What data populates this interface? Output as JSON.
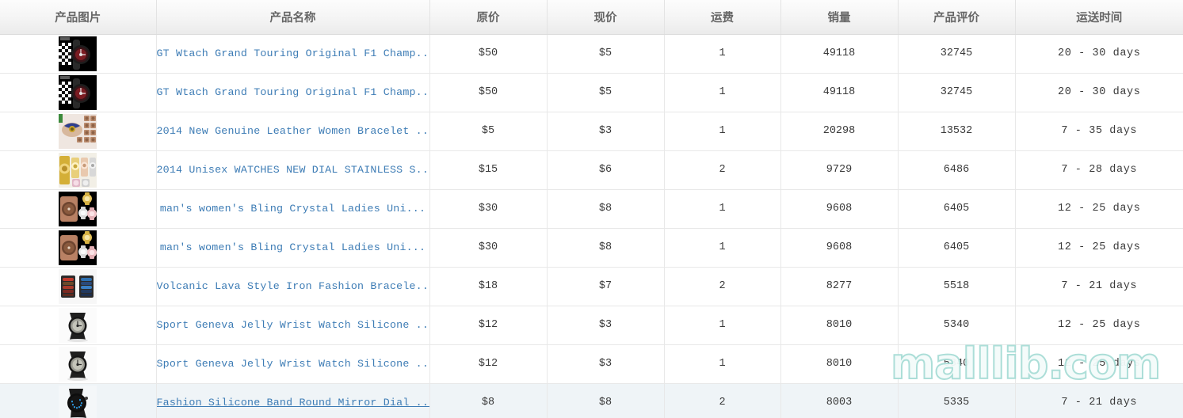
{
  "table": {
    "columns": [
      {
        "key": "image",
        "label": "产品图片"
      },
      {
        "key": "name",
        "label": "产品名称"
      },
      {
        "key": "orig_price",
        "label": "原价"
      },
      {
        "key": "cur_price",
        "label": "现价"
      },
      {
        "key": "shipping_fee",
        "label": "运费"
      },
      {
        "key": "sales",
        "label": "销量"
      },
      {
        "key": "reviews",
        "label": "产品评价"
      },
      {
        "key": "ship_time",
        "label": "运送时间"
      }
    ],
    "rows": [
      {
        "image_alt": "product-thumbnail-gt-watch-f1-chequered",
        "name": "GT Wtach Grand Touring Original F1 Champ...",
        "orig_price": "$50",
        "cur_price": "$5",
        "shipping_fee": "1",
        "sales": "49118",
        "reviews": "32745",
        "ship_time": "20 - 30 days",
        "highlight": false
      },
      {
        "image_alt": "product-thumbnail-gt-watch-f1-chequered",
        "name": "GT Wtach Grand Touring Original F1 Champ...",
        "orig_price": "$50",
        "cur_price": "$5",
        "shipping_fee": "1",
        "sales": "49118",
        "reviews": "32745",
        "ship_time": "20 - 30 days",
        "highlight": false
      },
      {
        "image_alt": "product-thumbnail-leather-bracelet-women",
        "name": "2014 New Genuine Leather Women Bracelet ...",
        "orig_price": "$5",
        "cur_price": "$3",
        "shipping_fee": "1",
        "sales": "20298",
        "reviews": "13532",
        "ship_time": "7 - 35 days",
        "highlight": false
      },
      {
        "image_alt": "product-thumbnail-unisex-stainless-watches",
        "name": "2014 Unisex WATCHES NEW DIAL STAINLESS S...",
        "orig_price": "$15",
        "cur_price": "$6",
        "shipping_fee": "2",
        "sales": "9729",
        "reviews": "6486",
        "ship_time": "7 - 28 days",
        "highlight": false
      },
      {
        "image_alt": "product-thumbnail-bling-crystal-ladies",
        "name": "man's women's Bling Crystal Ladies Uni...",
        "orig_price": "$30",
        "cur_price": "$8",
        "shipping_fee": "1",
        "sales": "9608",
        "reviews": "6405",
        "ship_time": "12 - 25 days",
        "highlight": false
      },
      {
        "image_alt": "product-thumbnail-bling-crystal-ladies",
        "name": "man's women's Bling Crystal Ladies Uni...",
        "orig_price": "$30",
        "cur_price": "$8",
        "shipping_fee": "1",
        "sales": "9608",
        "reviews": "6405",
        "ship_time": "12 - 25 days",
        "highlight": false
      },
      {
        "image_alt": "product-thumbnail-volcanic-lava-iron-bracelet",
        "name": "Volcanic Lava Style Iron Fashion Bracele...",
        "orig_price": "$18",
        "cur_price": "$7",
        "shipping_fee": "2",
        "sales": "8277",
        "reviews": "5518",
        "ship_time": "7 - 21 days",
        "highlight": false
      },
      {
        "image_alt": "product-thumbnail-geneva-jelly-silicone-watch",
        "name": "Sport Geneva Jelly Wrist Watch Silicone ...",
        "orig_price": "$12",
        "cur_price": "$3",
        "shipping_fee": "1",
        "sales": "8010",
        "reviews": "5340",
        "ship_time": "12 - 25 days",
        "highlight": false
      },
      {
        "image_alt": "product-thumbnail-geneva-jelly-silicone-watch",
        "name": "Sport Geneva Jelly Wrist Watch Silicone ...",
        "orig_price": "$12",
        "cur_price": "$3",
        "shipping_fee": "1",
        "sales": "8010",
        "reviews": "5340",
        "ship_time": "12 - 25 days",
        "highlight": false
      },
      {
        "image_alt": "product-thumbnail-silicone-band-mirror-dial-led",
        "name": "Fashion Silicone Band Round Mirror Dial ...",
        "orig_price": "$8",
        "cur_price": "$8",
        "shipping_fee": "2",
        "sales": "8003",
        "reviews": "5335",
        "ship_time": "7 - 21 days",
        "highlight": true
      }
    ]
  },
  "watermark": {
    "text": "malllib.com"
  },
  "colors": {
    "link": "#3d7cb5",
    "header_text": "#666666",
    "cell_text": "#3a3a3a",
    "row_highlight": "#eff4f7",
    "border": "#e8e8e8",
    "watermark_stroke": "#a8ddd6"
  }
}
